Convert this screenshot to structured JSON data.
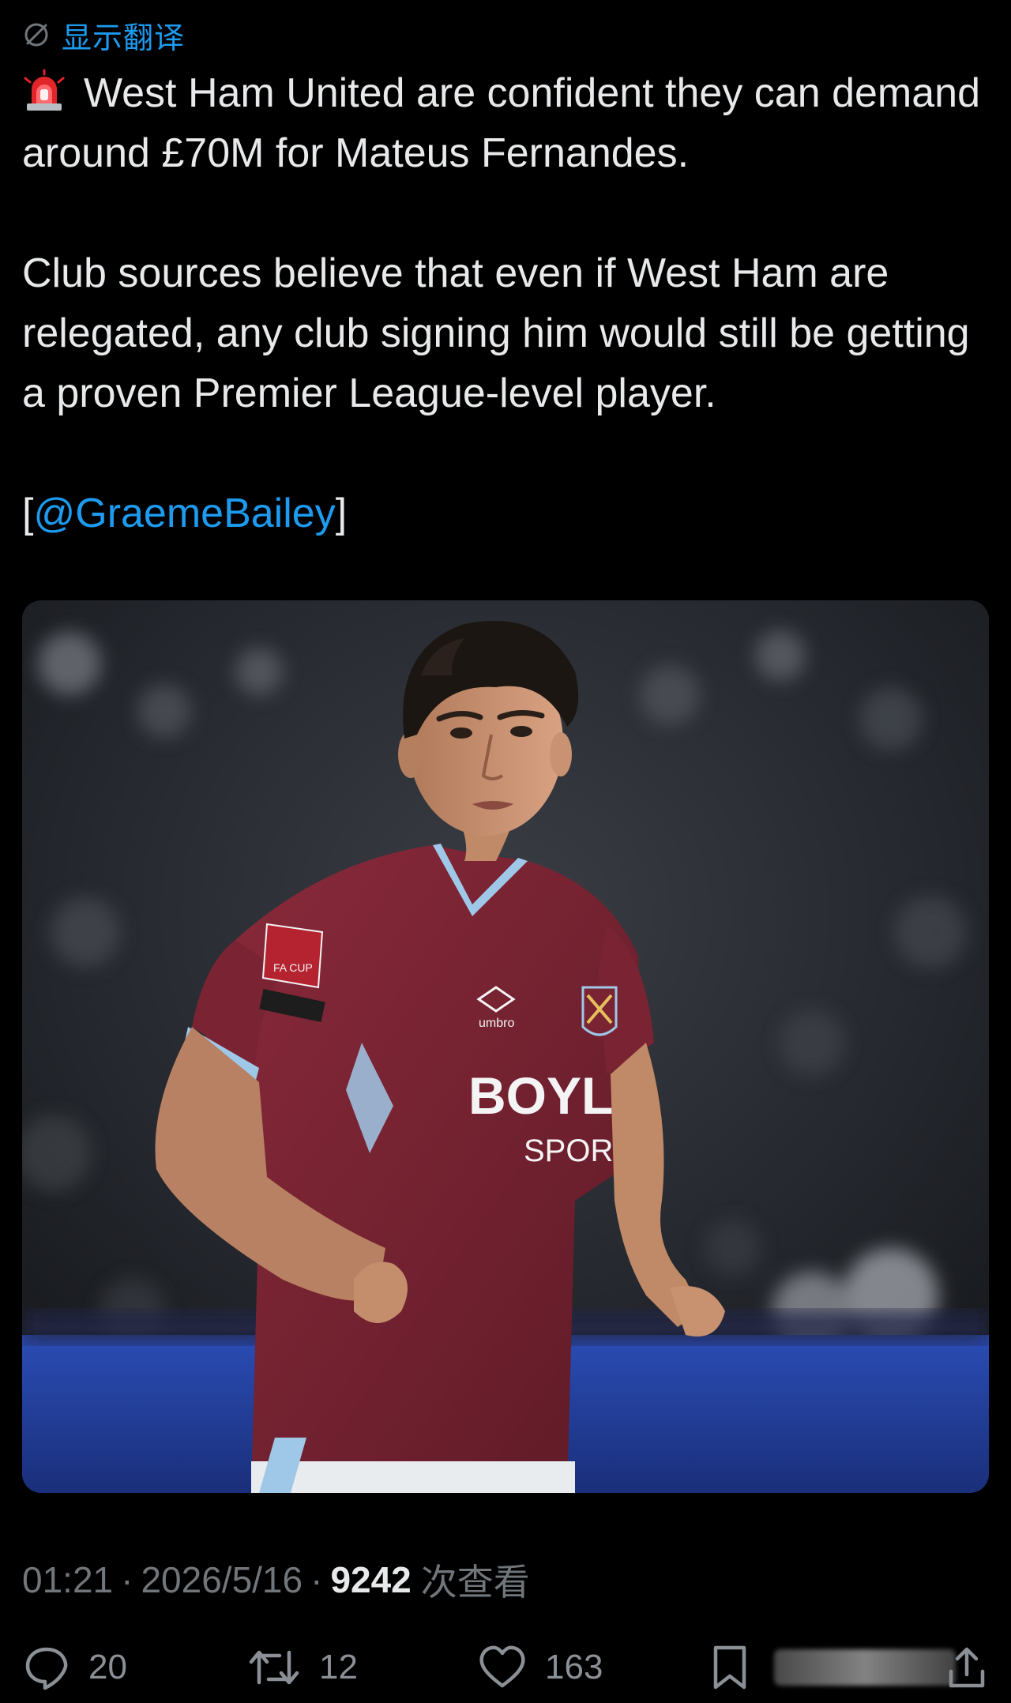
{
  "translate": {
    "label": "显示翻译",
    "icon": "translate-icon"
  },
  "tweet": {
    "siren_icon": "police-siren-emoji",
    "line1": "West Ham United are confident they can demand around £70M for Mateus Fernandes.",
    "paragraph2": "Club sources believe that even if West Ham are relegated, any club signing him would still be getting a proven Premier League-level player.",
    "source_open": "[",
    "source_handle": "@GraemeBailey",
    "source_close": "]"
  },
  "media": {
    "kit": {
      "sponsor_line1": "BOYLE",
      "sponsor_line2": "SPORTS",
      "brand": "umbro",
      "patch": "FA CUP"
    },
    "colors": {
      "shirt": "#7a2433",
      "shirt_trim": "#9fc8e8",
      "pitch": "#1d3a8f"
    }
  },
  "meta": {
    "time": "01:21",
    "separator": "·",
    "date": "2026/5/16",
    "views_count": "9242",
    "views_label": "次查看"
  },
  "actions": {
    "reply_count": "20",
    "retweet_count": "12",
    "like_count": "163"
  },
  "colors": {
    "background": "#000000",
    "text": "#e7e9ea",
    "secondary": "#71767b",
    "accent": "#1d9bf0"
  }
}
